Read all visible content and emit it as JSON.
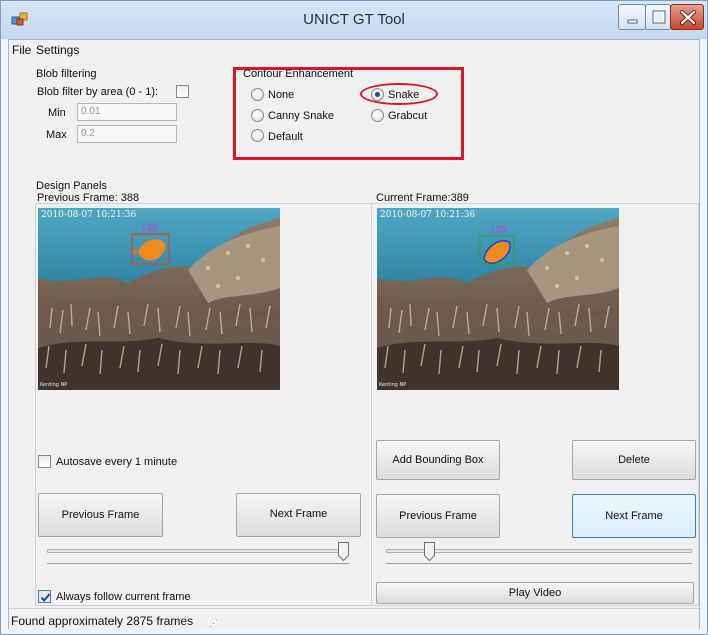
{
  "window": {
    "title": "UNICT GT Tool"
  },
  "menu": {
    "items": [
      "File",
      "Settings"
    ]
  },
  "blob_filtering": {
    "group_label": "Blob filtering",
    "checkbox_label": "Blob filter by area (0 - 1):",
    "checked": false,
    "min_label": "Min",
    "min_value": "0.01",
    "max_label": "Max",
    "max_value": "0.2"
  },
  "contour": {
    "group_label": "Contour Enhancement",
    "options": [
      "None",
      "Snake",
      "Canny Snake",
      "Grabcut",
      "Default"
    ],
    "selected": "Snake"
  },
  "design_panels": {
    "label": "Design Panels",
    "previous_frame_label": "Previous Frame: 388",
    "current_frame_label": "Current Frame:389",
    "timestamp": "2010-08-07 10:21:36",
    "bbox_id": "139",
    "autosave_label": "Autosave every 1 minute",
    "autosave_checked": false,
    "follow_label": "Always follow current frame",
    "follow_checked": true
  },
  "left_panel": {
    "prev_button": "Previous Frame",
    "next_button": "Next Frame",
    "slider_value": 1.0
  },
  "right_panel": {
    "add_bbox_button": "Add Bounding Box",
    "delete_button": "Delete",
    "prev_button": "Previous Frame",
    "next_button": "Next Frame",
    "play_button": "Play Video",
    "slider_value": 0.13
  },
  "status": {
    "text": "Found approximately 2875 frames"
  },
  "colors": {
    "highlight_red": "#d9142b",
    "titlebar": "#c4d9ef",
    "bbox_prev": "#e0402a",
    "bbox_curr": "#2aa53c"
  }
}
